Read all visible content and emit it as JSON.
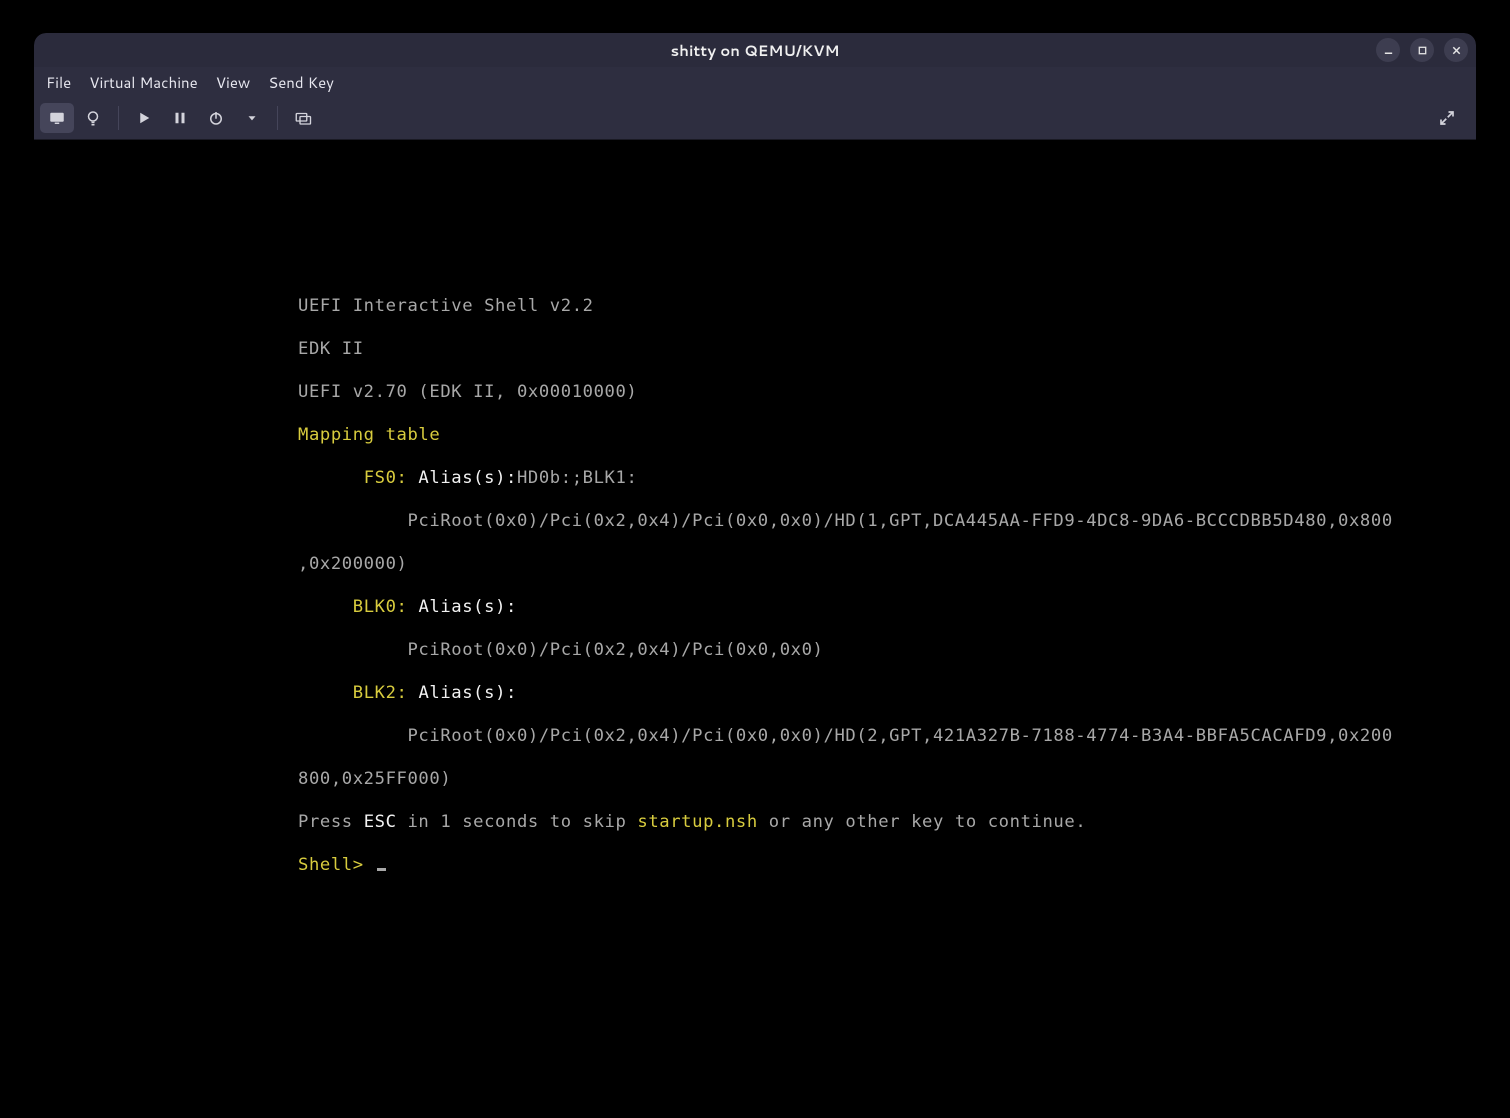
{
  "window": {
    "title": "shitty on QEMU/KVM"
  },
  "menubar": {
    "items": [
      "File",
      "Virtual Machine",
      "View",
      "Send Key"
    ]
  },
  "toolbar": {
    "console_button": "Show graphical console",
    "details_button": "Show VM details",
    "run_button": "Run",
    "pause_button": "Pause",
    "shutdown_button": "Shut down",
    "shutdown_menu_button": "Shutdown options",
    "screenshot_button": "Take screenshot",
    "fullscreen_button": "Fullscreen"
  },
  "console": {
    "header1": "UEFI Interactive Shell v2.2",
    "header2": "EDK II",
    "header3": "UEFI v2.70 (EDK II, 0x00010000)",
    "mapping_heading": "Mapping table",
    "fs0_label": "FS0:",
    "fs0_alias": " Alias(s):",
    "fs0_alias_val": "HD0b:;BLK1:",
    "fs0_path": "          PciRoot(0x0)/Pci(0x2,0x4)/Pci(0x0,0x0)/HD(1,GPT,DCA445AA-FFD9-4DC8-9DA6-BCCCDBB5D480,0x800",
    "fs0_path2": ",0x200000)",
    "blk0_label": "BLK0:",
    "blk0_alias": " Alias(s):",
    "blk0_path": "          PciRoot(0x0)/Pci(0x2,0x4)/Pci(0x0,0x0)",
    "blk2_label": "BLK2:",
    "blk2_alias": " Alias(s):",
    "blk2_path": "          PciRoot(0x0)/Pci(0x2,0x4)/Pci(0x0,0x0)/HD(2,GPT,421A327B-7188-4774-B3A4-BBFA5CACAFD9,0x200",
    "blk2_path2": "800,0x25FF000)",
    "press_pre": "Press ",
    "press_key": "ESC",
    "press_mid": " in 1 seconds to skip ",
    "press_file": "startup.nsh",
    "press_post": " or any other key to continue.",
    "prompt": "Shell> "
  }
}
